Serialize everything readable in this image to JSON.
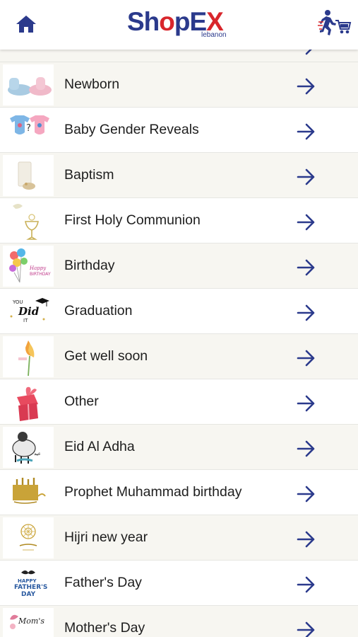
{
  "header": {
    "logo": {
      "brand": "ShopEX",
      "sub": "lebanon"
    },
    "home_icon": "home-icon",
    "cart_icon": "delivery-cart-icon"
  },
  "colors": {
    "navy": "#2b3a8c",
    "red": "#d8262c",
    "row_alt": "#f7f6f1"
  },
  "categories": [
    {
      "label": "Newborn",
      "icon": "baby-shoes-icon"
    },
    {
      "label": "Baby Gender Reveals",
      "icon": "baby-onesies-icon"
    },
    {
      "label": "Baptism",
      "icon": "baptism-candle-icon"
    },
    {
      "label": "First Holy Communion",
      "icon": "dove-chalice-icon"
    },
    {
      "label": "Birthday",
      "icon": "balloons-icon"
    },
    {
      "label": "Graduation",
      "icon": "graduation-cap-icon"
    },
    {
      "label": "Get well soon",
      "icon": "flower-icon"
    },
    {
      "label": "Other",
      "icon": "gift-box-icon"
    },
    {
      "label": "Eid Al Adha",
      "icon": "sheep-icon"
    },
    {
      "label": "Prophet Muhammad birthday",
      "icon": "mosque-gold-icon"
    },
    {
      "label": "Hijri new year",
      "icon": "ornament-gold-icon"
    },
    {
      "label": "Father's Day",
      "icon": "mustache-icon"
    },
    {
      "label": "Mother's Day",
      "icon": "mothers-day-icon"
    }
  ]
}
